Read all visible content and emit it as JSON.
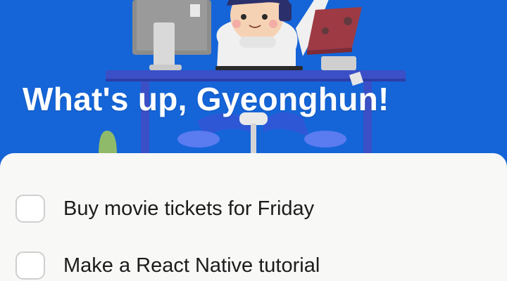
{
  "header": {
    "greeting": "What's up, Gyeonghun!"
  },
  "tasks": [
    {
      "label": "Buy movie tickets for Friday",
      "done": false
    },
    {
      "label": "Make a React Native tutorial",
      "done": false
    }
  ],
  "colors": {
    "hero_background": "#1565d8",
    "sheet_background": "#f8f8f7",
    "checkbox_border": "#cfcfcf",
    "task_text": "#1c1c1c"
  },
  "icons": {
    "hero_illustration": "person-at-desk-illustration"
  }
}
